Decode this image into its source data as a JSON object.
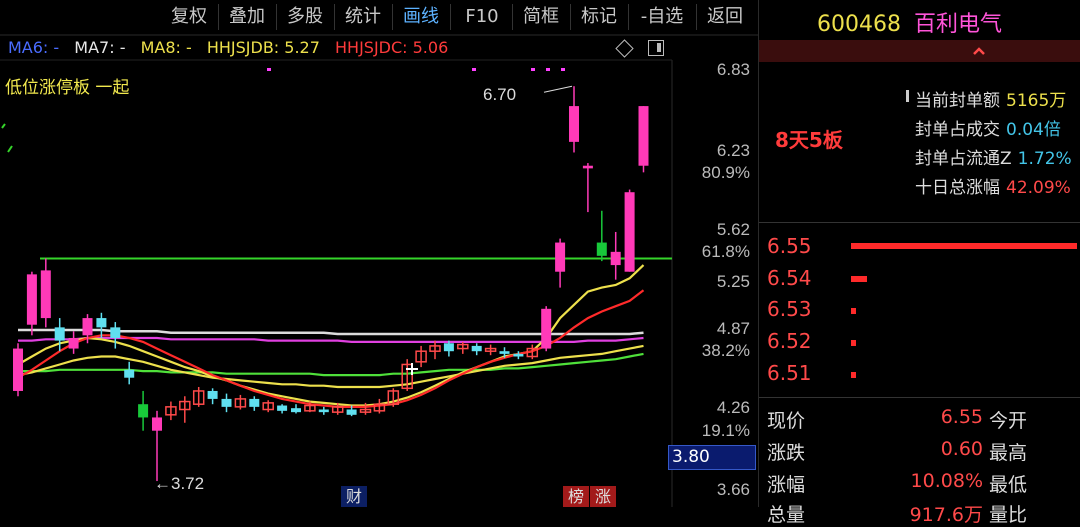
{
  "toolbar": {
    "items": [
      "复权",
      "叠加",
      "多股",
      "统计",
      "画线",
      "F10",
      "简框",
      "标记",
      "-自选",
      "返回"
    ],
    "active_index": 4
  },
  "ma_bar": {
    "ma6": "MA6: -",
    "ma7": "MA7: -",
    "ma8": "MA8: -",
    "hhjsjdb": "HHJSJDB: 5.27",
    "hhjsjdc": "HHJSJDC: 5.06",
    "colors": {
      "ma6": "#4a6cff",
      "ma7": "#e8e8e8",
      "ma8": "#ede04c",
      "hhjsjdb": "#ede04c",
      "hhjsjdc": "#ff3b3b"
    }
  },
  "indicator_label": "低位涨停板 一起",
  "chart_data": {
    "type": "candlestick",
    "y_axis_labels": [
      "6.83",
      "6.23",
      "80.9%",
      "5.62",
      "61.8%",
      "5.25",
      "4.87",
      "38.2%",
      "4.26",
      "19.1%",
      "3.66"
    ],
    "annotations": {
      "high": "6.70",
      "low": "←3.72"
    },
    "current_price_box": "3.80",
    "event_marks": [
      "财",
      "榜",
      "涨"
    ],
    "candles": [
      {
        "o": 4.4,
        "c": 4.72,
        "h": 4.76,
        "l": 4.36,
        "up": true
      },
      {
        "o": 4.9,
        "c": 5.28,
        "h": 5.3,
        "l": 4.82,
        "up": true
      },
      {
        "o": 4.95,
        "c": 5.31,
        "h": 5.4,
        "l": 4.88,
        "up": false
      },
      {
        "o": 4.88,
        "c": 4.78,
        "h": 4.95,
        "l": 4.7,
        "up": false
      },
      {
        "o": 4.72,
        "c": 4.8,
        "h": 4.85,
        "l": 4.68,
        "up": true
      },
      {
        "o": 4.82,
        "c": 4.95,
        "h": 4.98,
        "l": 4.76,
        "up": true
      },
      {
        "o": 4.95,
        "c": 4.88,
        "h": 4.99,
        "l": 4.8,
        "up": false
      },
      {
        "o": 4.88,
        "c": 4.8,
        "h": 4.92,
        "l": 4.72,
        "up": false
      },
      {
        "o": 4.56,
        "c": 4.5,
        "h": 4.62,
        "l": 4.45,
        "up": false
      },
      {
        "o": 4.3,
        "c": 4.2,
        "h": 4.4,
        "l": 4.1,
        "up": false
      },
      {
        "o": 4.1,
        "c": 4.2,
        "h": 4.25,
        "l": 3.72,
        "up": true
      },
      {
        "o": 4.22,
        "c": 4.28,
        "h": 4.32,
        "l": 4.18,
        "up": true
      },
      {
        "o": 4.26,
        "c": 4.32,
        "h": 4.36,
        "l": 4.16,
        "up": true
      },
      {
        "o": 4.3,
        "c": 4.4,
        "h": 4.43,
        "l": 4.28,
        "up": true
      },
      {
        "o": 4.4,
        "c": 4.34,
        "h": 4.42,
        "l": 4.3,
        "up": false
      },
      {
        "o": 4.34,
        "c": 4.28,
        "h": 4.38,
        "l": 4.24,
        "up": false
      },
      {
        "o": 4.28,
        "c": 4.34,
        "h": 4.37,
        "l": 4.26,
        "up": true
      },
      {
        "o": 4.34,
        "c": 4.28,
        "h": 4.36,
        "l": 4.25,
        "up": true
      },
      {
        "o": 4.26,
        "c": 4.31,
        "h": 4.33,
        "l": 4.24,
        "up": true
      },
      {
        "o": 4.29,
        "c": 4.25,
        "h": 4.3,
        "l": 4.23,
        "up": false
      },
      {
        "o": 4.27,
        "c": 4.24,
        "h": 4.3,
        "l": 4.23,
        "up": false
      },
      {
        "o": 4.25,
        "c": 4.29,
        "h": 4.32,
        "l": 4.24,
        "up": true
      },
      {
        "o": 4.26,
        "c": 4.24,
        "h": 4.28,
        "l": 4.22,
        "up": false
      },
      {
        "o": 4.24,
        "c": 4.28,
        "h": 4.31,
        "l": 4.22,
        "up": true
      },
      {
        "o": 4.26,
        "c": 4.22,
        "h": 4.29,
        "l": 4.21,
        "up": false
      },
      {
        "o": 4.24,
        "c": 4.26,
        "h": 4.31,
        "l": 4.22,
        "up": true
      },
      {
        "o": 4.25,
        "c": 4.3,
        "h": 4.34,
        "l": 4.23,
        "up": true
      },
      {
        "o": 4.3,
        "c": 4.4,
        "h": 4.42,
        "l": 4.28,
        "up": true
      },
      {
        "o": 4.42,
        "c": 4.6,
        "h": 4.64,
        "l": 4.4,
        "up": true
      },
      {
        "o": 4.62,
        "c": 4.7,
        "h": 4.74,
        "l": 4.58,
        "up": true
      },
      {
        "o": 4.7,
        "c": 4.74,
        "h": 4.78,
        "l": 4.64,
        "up": true
      },
      {
        "o": 4.76,
        "c": 4.7,
        "h": 4.78,
        "l": 4.66,
        "up": false
      },
      {
        "o": 4.72,
        "c": 4.75,
        "h": 4.77,
        "l": 4.68,
        "up": true
      },
      {
        "o": 4.74,
        "c": 4.7,
        "h": 4.76,
        "l": 4.67,
        "up": false
      },
      {
        "o": 4.7,
        "c": 4.72,
        "h": 4.75,
        "l": 4.67,
        "up": true
      },
      {
        "o": 4.7,
        "c": 4.68,
        "h": 4.73,
        "l": 4.65,
        "up": false
      },
      {
        "o": 4.68,
        "c": 4.66,
        "h": 4.7,
        "l": 4.64,
        "up": false
      },
      {
        "o": 4.66,
        "c": 4.72,
        "h": 4.75,
        "l": 4.64,
        "up": true
      },
      {
        "o": 4.72,
        "c": 5.02,
        "h": 5.04,
        "l": 4.7,
        "up": true
      },
      {
        "o": 5.3,
        "c": 5.52,
        "h": 5.55,
        "l": 5.18,
        "up": true
      },
      {
        "o": 6.28,
        "c": 6.55,
        "h": 6.7,
        "l": 6.2,
        "up": false
      },
      {
        "o": 6.08,
        "c": 6.1,
        "h": 6.12,
        "l": 5.75,
        "up": true
      },
      {
        "o": 5.52,
        "c": 5.42,
        "h": 5.76,
        "l": 5.38,
        "up": false
      },
      {
        "o": 5.35,
        "c": 5.45,
        "h": 5.6,
        "l": 5.24,
        "up": true
      },
      {
        "o": 5.3,
        "c": 5.9,
        "h": 5.92,
        "l": 5.3,
        "up": true
      },
      {
        "o": 6.1,
        "c": 6.55,
        "h": 6.55,
        "l": 6.05,
        "up": true
      }
    ],
    "lines": [
      {
        "name": "white",
        "color": "#dcdcdc",
        "values": [
          4.86,
          4.86,
          4.86,
          4.86,
          4.86,
          4.86,
          4.86,
          4.85,
          4.85,
          4.85,
          4.85,
          4.84,
          4.84,
          4.84,
          4.84,
          4.84,
          4.84,
          4.84,
          4.84,
          4.84,
          4.84,
          4.84,
          4.84,
          4.83,
          4.83,
          4.83,
          4.83,
          4.83,
          4.83,
          4.83,
          4.83,
          4.83,
          4.83,
          4.83,
          4.83,
          4.83,
          4.83,
          4.83,
          4.83,
          4.83,
          4.83,
          4.83,
          4.83,
          4.83,
          4.83,
          4.84
        ]
      },
      {
        "name": "magenta",
        "color": "#e040e0",
        "values": [
          4.78,
          4.78,
          4.79,
          4.79,
          4.79,
          4.8,
          4.8,
          4.8,
          4.8,
          4.8,
          4.8,
          4.79,
          4.79,
          4.79,
          4.79,
          4.79,
          4.79,
          4.79,
          4.78,
          4.78,
          4.78,
          4.78,
          4.78,
          4.78,
          4.77,
          4.77,
          4.77,
          4.77,
          4.77,
          4.77,
          4.77,
          4.77,
          4.77,
          4.77,
          4.77,
          4.77,
          4.77,
          4.77,
          4.77,
          4.77,
          4.77,
          4.78,
          4.78,
          4.78,
          4.79,
          4.8
        ]
      },
      {
        "name": "green",
        "color": "#4fe03a",
        "values": [
          4.55,
          4.55,
          4.55,
          4.56,
          4.56,
          4.56,
          4.56,
          4.56,
          4.56,
          4.55,
          4.55,
          4.54,
          4.54,
          4.54,
          4.54,
          4.53,
          4.53,
          4.53,
          4.53,
          4.53,
          4.53,
          4.53,
          4.52,
          4.52,
          4.52,
          4.52,
          4.52,
          4.53,
          4.53,
          4.54,
          4.55,
          4.56,
          4.56,
          4.56,
          4.56,
          4.57,
          4.57,
          4.58,
          4.59,
          4.6,
          4.61,
          4.62,
          4.63,
          4.64,
          4.66,
          4.68
        ]
      },
      {
        "name": "yellow1",
        "color": "#ede04c",
        "values": [
          4.6,
          4.66,
          4.72,
          4.76,
          4.78,
          4.8,
          4.79,
          4.77,
          4.74,
          4.7,
          4.66,
          4.62,
          4.58,
          4.55,
          4.51,
          4.48,
          4.44,
          4.41,
          4.38,
          4.36,
          4.34,
          4.32,
          4.31,
          4.3,
          4.29,
          4.29,
          4.3,
          4.32,
          4.35,
          4.39,
          4.44,
          4.49,
          4.54,
          4.58,
          4.62,
          4.66,
          4.68,
          4.7,
          4.8,
          4.95,
          5.05,
          5.15,
          5.18,
          5.2,
          5.25,
          5.35
        ]
      },
      {
        "name": "yellow2",
        "color": "#ede04c",
        "values": [
          4.52,
          4.54,
          4.57,
          4.6,
          4.63,
          4.65,
          4.66,
          4.66,
          4.64,
          4.62,
          4.59,
          4.56,
          4.54,
          4.52,
          4.5,
          4.49,
          4.48,
          4.47,
          4.46,
          4.45,
          4.45,
          4.44,
          4.44,
          4.43,
          4.43,
          4.43,
          4.43,
          4.44,
          4.45,
          4.47,
          4.49,
          4.51,
          4.53,
          4.55,
          4.57,
          4.59,
          4.6,
          4.61,
          4.63,
          4.65,
          4.66,
          4.67,
          4.68,
          4.7,
          4.72,
          4.74
        ]
      },
      {
        "name": "red",
        "color": "#ff2a2a",
        "values": [
          4.5,
          4.56,
          4.63,
          4.7,
          4.76,
          4.8,
          4.82,
          4.82,
          4.8,
          4.77,
          4.72,
          4.67,
          4.62,
          4.57,
          4.52,
          4.48,
          4.44,
          4.4,
          4.37,
          4.34,
          4.32,
          4.3,
          4.29,
          4.28,
          4.28,
          4.28,
          4.29,
          4.3,
          4.33,
          4.37,
          4.42,
          4.48,
          4.53,
          4.58,
          4.62,
          4.65,
          4.68,
          4.7,
          4.74,
          4.8,
          4.88,
          4.95,
          5.0,
          5.04,
          5.08,
          5.16
        ]
      }
    ],
    "horizontal_line": {
      "value": 5.4,
      "color": "#35d42a"
    }
  },
  "right_panel": {
    "code": "600468",
    "name": "百利电气",
    "board_label": "8天5板",
    "info": [
      {
        "label": "当前封单额",
        "value": "5165万"
      },
      {
        "label": "封单占成交",
        "value": "0.04倍"
      },
      {
        "label": "封单占流通Z",
        "value": "1.72%"
      },
      {
        "label": "十日总涨幅",
        "value": "42.09%"
      }
    ],
    "order_book": [
      {
        "price": "6.55",
        "fill": 1.0
      },
      {
        "price": "6.54",
        "fill": 0.07
      },
      {
        "price": "6.53",
        "fill": 0.02
      },
      {
        "price": "6.52",
        "fill": 0.02
      },
      {
        "price": "6.51",
        "fill": 0.02
      }
    ],
    "quote": [
      {
        "label": "现价",
        "value": "6.55",
        "label2": "今开"
      },
      {
        "label": "涨跌",
        "value": "0.60",
        "label2": "最高"
      },
      {
        "label": "涨幅",
        "value": "10.08%",
        "label2": "最低"
      },
      {
        "label": "总量",
        "value": "917.6万",
        "label2": "量比"
      }
    ]
  }
}
